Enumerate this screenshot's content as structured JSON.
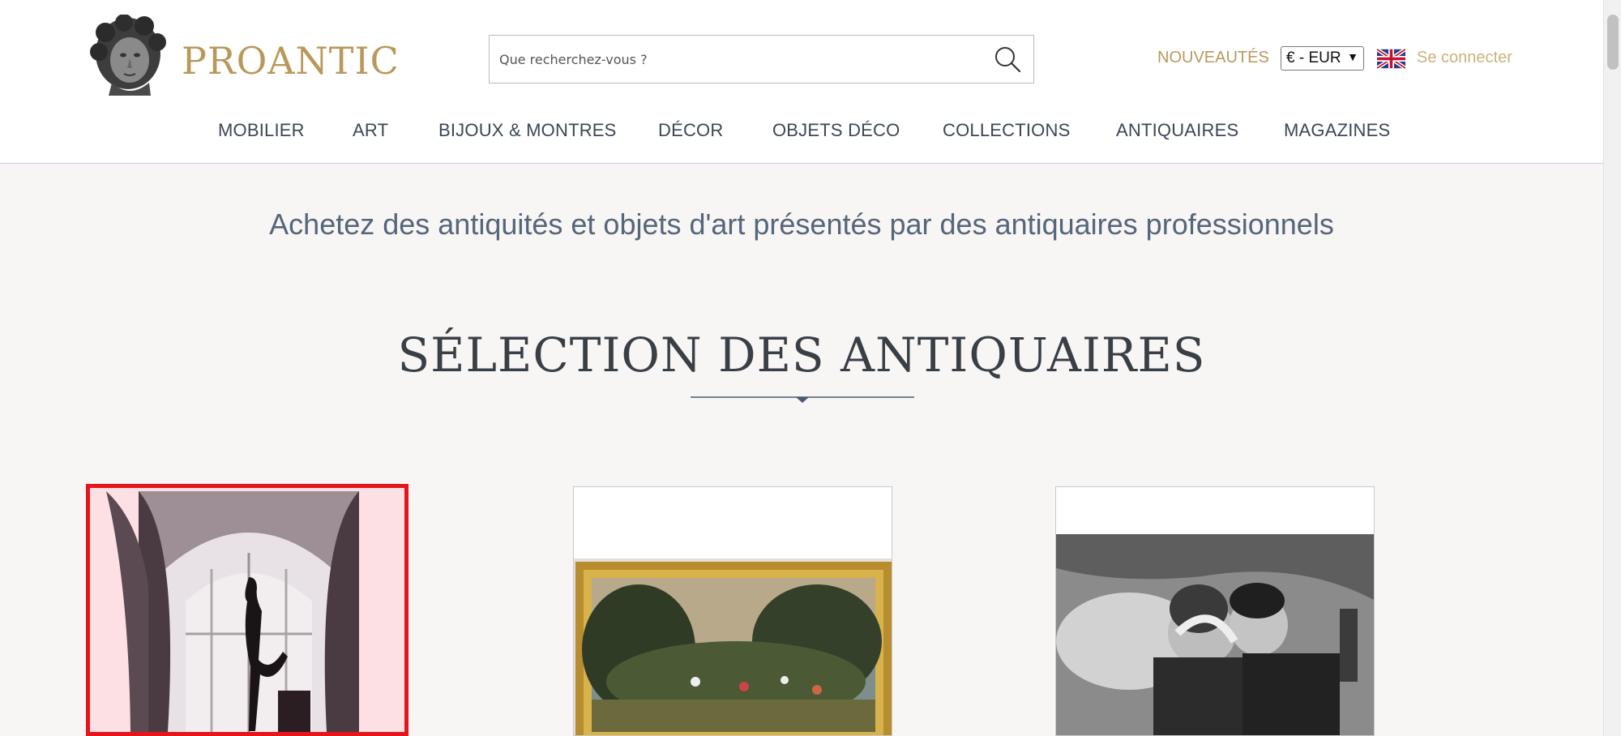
{
  "header": {
    "logo_text": "PROANTIC",
    "search": {
      "placeholder": "Que recherchez-vous ?"
    },
    "nouveautes": "NOUVEAUTÉS",
    "currency": "€ - EUR",
    "login": "Se connecter"
  },
  "nav": {
    "items": [
      {
        "label": "MOBILIER"
      },
      {
        "label": "ART"
      },
      {
        "label": "BIJOUX & MONTRES"
      },
      {
        "label": "DÉCOR"
      },
      {
        "label": "OBJETS DÉCO"
      },
      {
        "label": "COLLECTIONS"
      },
      {
        "label": "ANTIQUAIRES"
      },
      {
        "label": "MAGAZINES"
      }
    ]
  },
  "main": {
    "tagline": "Achetez des antiquités et objets d'art présentés par des antiquaires professionnels",
    "section_title": "SÉLECTION DES ANTIQUAIRES"
  },
  "colors": {
    "gold": "#b8995a",
    "highlight": "#e8141c",
    "nav_text": "#3c4656"
  }
}
